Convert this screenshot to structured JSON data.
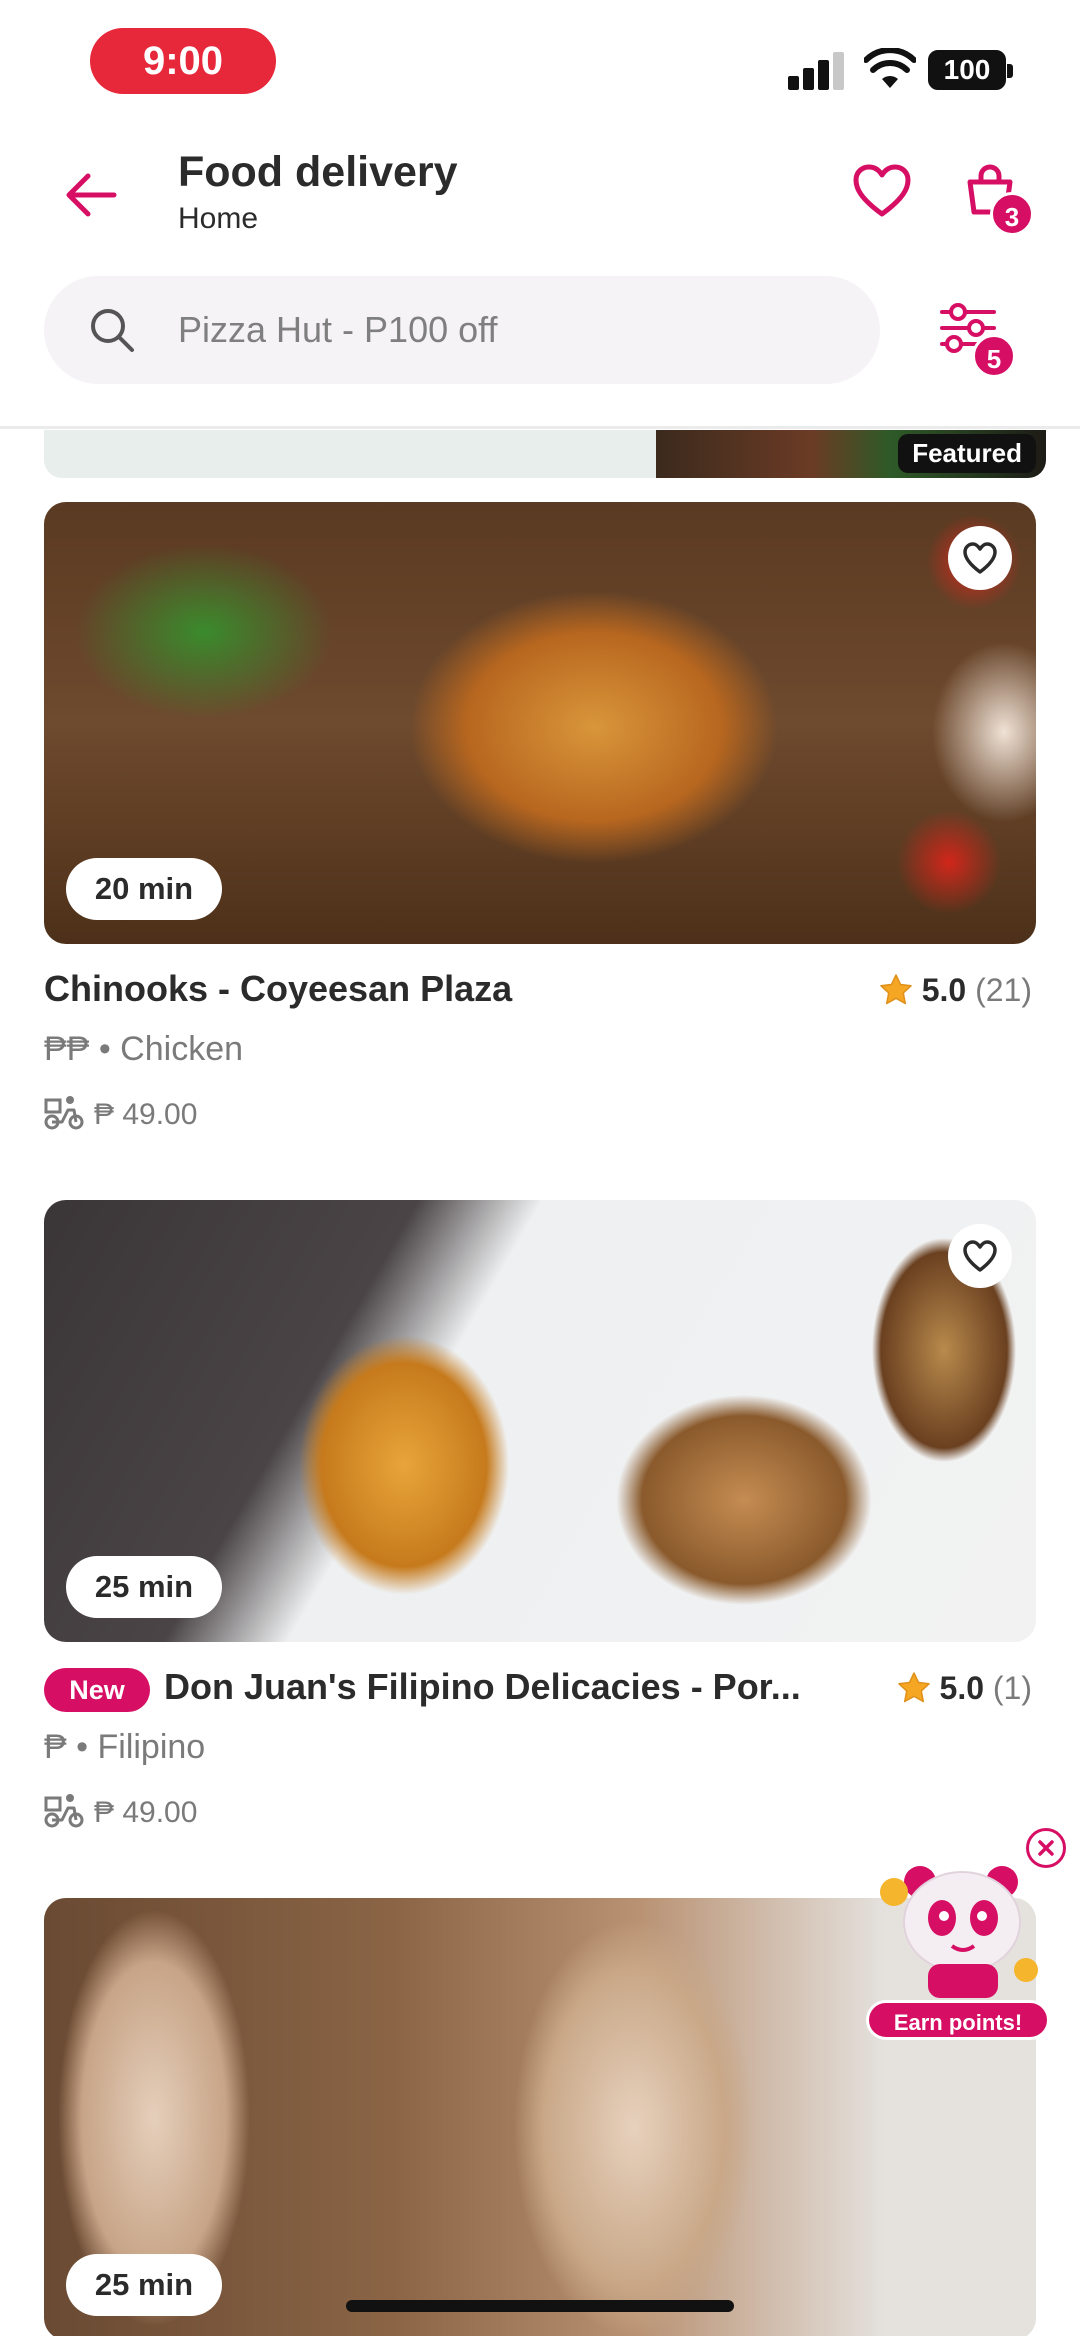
{
  "status_bar": {
    "time": "9:00",
    "battery": "100"
  },
  "header": {
    "title": "Food delivery",
    "subtitle": "Home",
    "cart_count": "3"
  },
  "search": {
    "placeholder": "Pizza Hut - P100 off",
    "filter_count": "5"
  },
  "featured": {
    "tag": "Featured"
  },
  "restaurants": [
    {
      "delivery_time": "20 min",
      "name": "Chinooks - Coyeesan Plaza",
      "rating": "5.0",
      "reviews": "(21)",
      "price_level": "₱₱",
      "cuisine": "Chicken",
      "delivery_fee": "₱ 49.00"
    },
    {
      "delivery_time": "25 min",
      "badge": "New",
      "name": "Don Juan's Filipino Delicacies - Por...",
      "rating": "5.0",
      "reviews": "(1)",
      "price_level": "₱",
      "cuisine": "Filipino",
      "delivery_fee": "₱ 49.00"
    },
    {
      "delivery_time": "25 min"
    }
  ],
  "promo": {
    "label": "Earn points!"
  },
  "colors": {
    "brand": "#d70f64",
    "time_pill": "#e6283a",
    "star": "#f5a623"
  },
  "icons": [
    "back-arrow-icon",
    "heart-icon",
    "cart-icon",
    "search-icon",
    "filter-icon",
    "star-icon",
    "delivery-scooter-icon",
    "close-icon"
  ]
}
